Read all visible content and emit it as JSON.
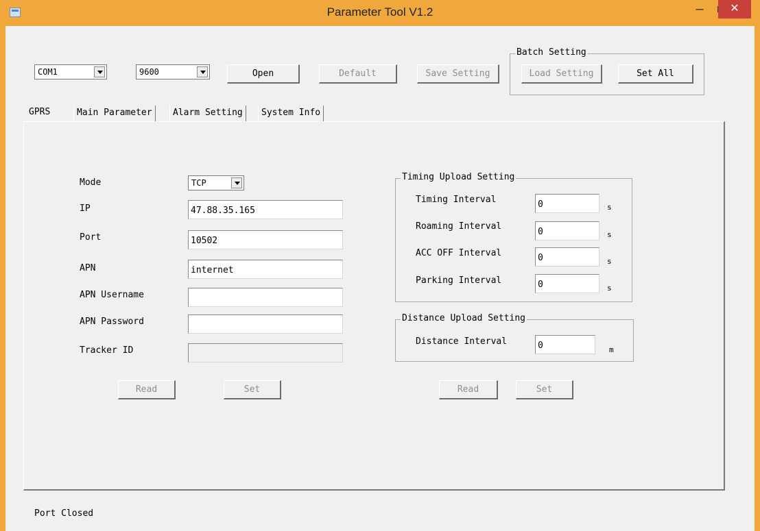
{
  "window": {
    "title": "Parameter Tool V1.2",
    "minimize": "–",
    "close": "✕",
    "colors": {
      "frame": "#f0a83c",
      "close": "#c7403a",
      "client": "#f0f0f0"
    }
  },
  "toolbar": {
    "port_value": "COM1",
    "baud_value": "9600",
    "open_label": "Open",
    "default_label": "Default",
    "save_label": "Save Setting"
  },
  "batch": {
    "legend": "Batch Setting",
    "load_label": "Load Setting",
    "set_all_label": "Set All"
  },
  "tabs": [
    "GPRS",
    "Main Parameter",
    "Alarm Setting",
    "System Info"
  ],
  "gprs": {
    "mode_label": "Mode",
    "mode_value": "TCP",
    "ip_label": "IP",
    "ip_value": "47.88.35.165",
    "port_label": "Port",
    "port_value": "10502",
    "apn_label": "APN",
    "apn_value": "internet",
    "apn_user_label": "APN Username",
    "apn_user_value": "",
    "apn_pass_label": "APN Password",
    "apn_pass_value": "",
    "tracker_label": "Tracker ID",
    "tracker_value": "",
    "read_label": "Read",
    "set_label": "Set"
  },
  "timing": {
    "legend": "Timing Upload Setting",
    "rows": [
      {
        "label": "Timing Interval",
        "value": "0",
        "unit": "s"
      },
      {
        "label": "Roaming Interval",
        "value": "0",
        "unit": "s"
      },
      {
        "label": "ACC OFF Interval",
        "value": "0",
        "unit": "s"
      },
      {
        "label": "Parking Interval",
        "value": "0",
        "unit": "s"
      }
    ]
  },
  "distance": {
    "legend": "Distance Upload Setting",
    "label": "Distance Interval",
    "value": "0",
    "unit": "m"
  },
  "upload": {
    "read_label": "Read",
    "set_label": "Set"
  },
  "status": "Port Closed"
}
